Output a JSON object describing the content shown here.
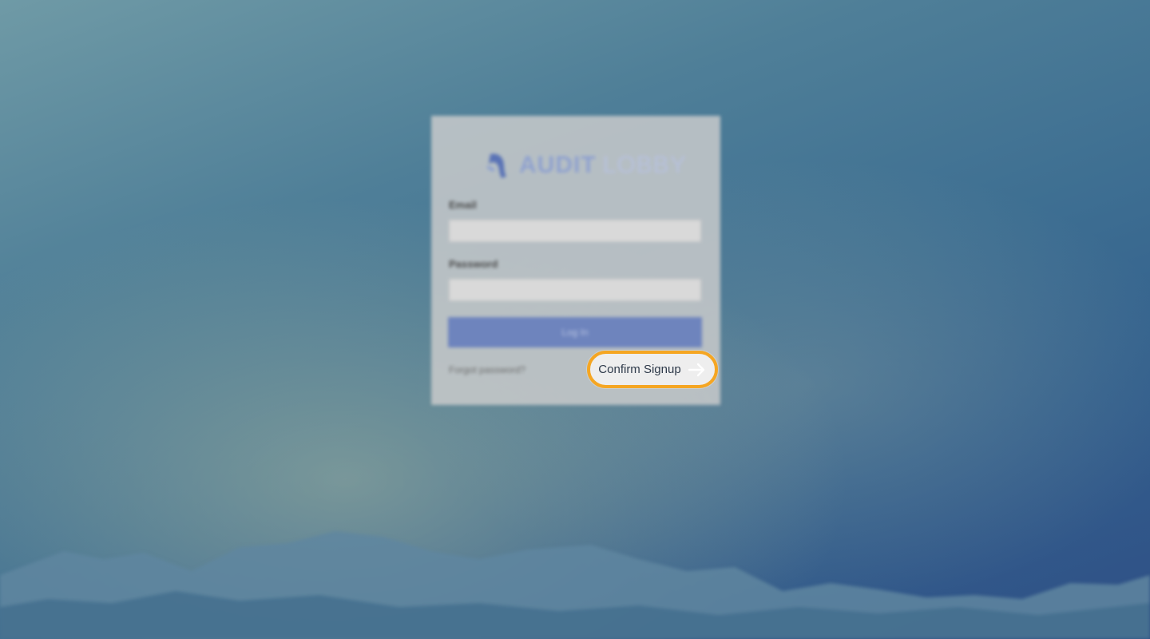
{
  "brand": {
    "logo_primary": "AUDIT",
    "logo_secondary": "LOBBY",
    "accent_color": "#6e84bd",
    "highlight_color": "#f5a623"
  },
  "login_form": {
    "email_label": "Email",
    "password_label": "Password",
    "email_value": "",
    "password_value": "",
    "login_button": "Log In",
    "forgot_link": "Forgot password?"
  },
  "cta": {
    "confirm_signup_label": "Confirm Signup",
    "icon": "arrow-right-icon"
  }
}
